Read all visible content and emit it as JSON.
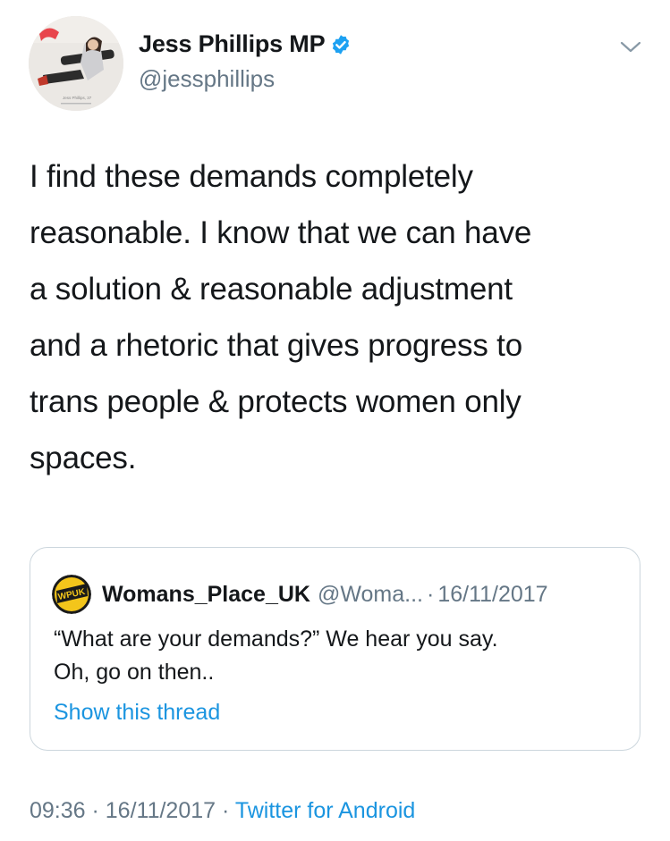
{
  "author": {
    "display_name": "Jess Phillips MP",
    "handle": "@jessphillips",
    "verified": true,
    "avatar_caption": "Jess Phillips, 37"
  },
  "tweet": {
    "text": "I find these demands completely\nreasonable. I know that we can have\na solution &  reasonable adjustment\nand a rhetoric that gives progress to\ntrans people & protects women only\nspaces."
  },
  "quoted_tweet": {
    "display_name": "Womans_Place_UK",
    "handle": "@Woma...",
    "separator": "·",
    "date": "16/11/2017",
    "text": "“What are your demands?” We hear you say.\nOh, go on then..",
    "show_thread_label": "Show this thread",
    "avatar_text": "WPUK"
  },
  "meta": {
    "time": "09:36",
    "sep1": " · ",
    "date": "16/11/2017",
    "sep2": " · ",
    "source": "Twitter for Android"
  },
  "icons": {
    "verified": "verified-badge-icon",
    "menu": "chevron-down-icon"
  },
  "colors": {
    "link": "#1b95e0",
    "verified": "#1da1f2",
    "secondary_text": "#657786",
    "border": "#ccd6dd",
    "quote_avatar": "#f3c51b"
  }
}
